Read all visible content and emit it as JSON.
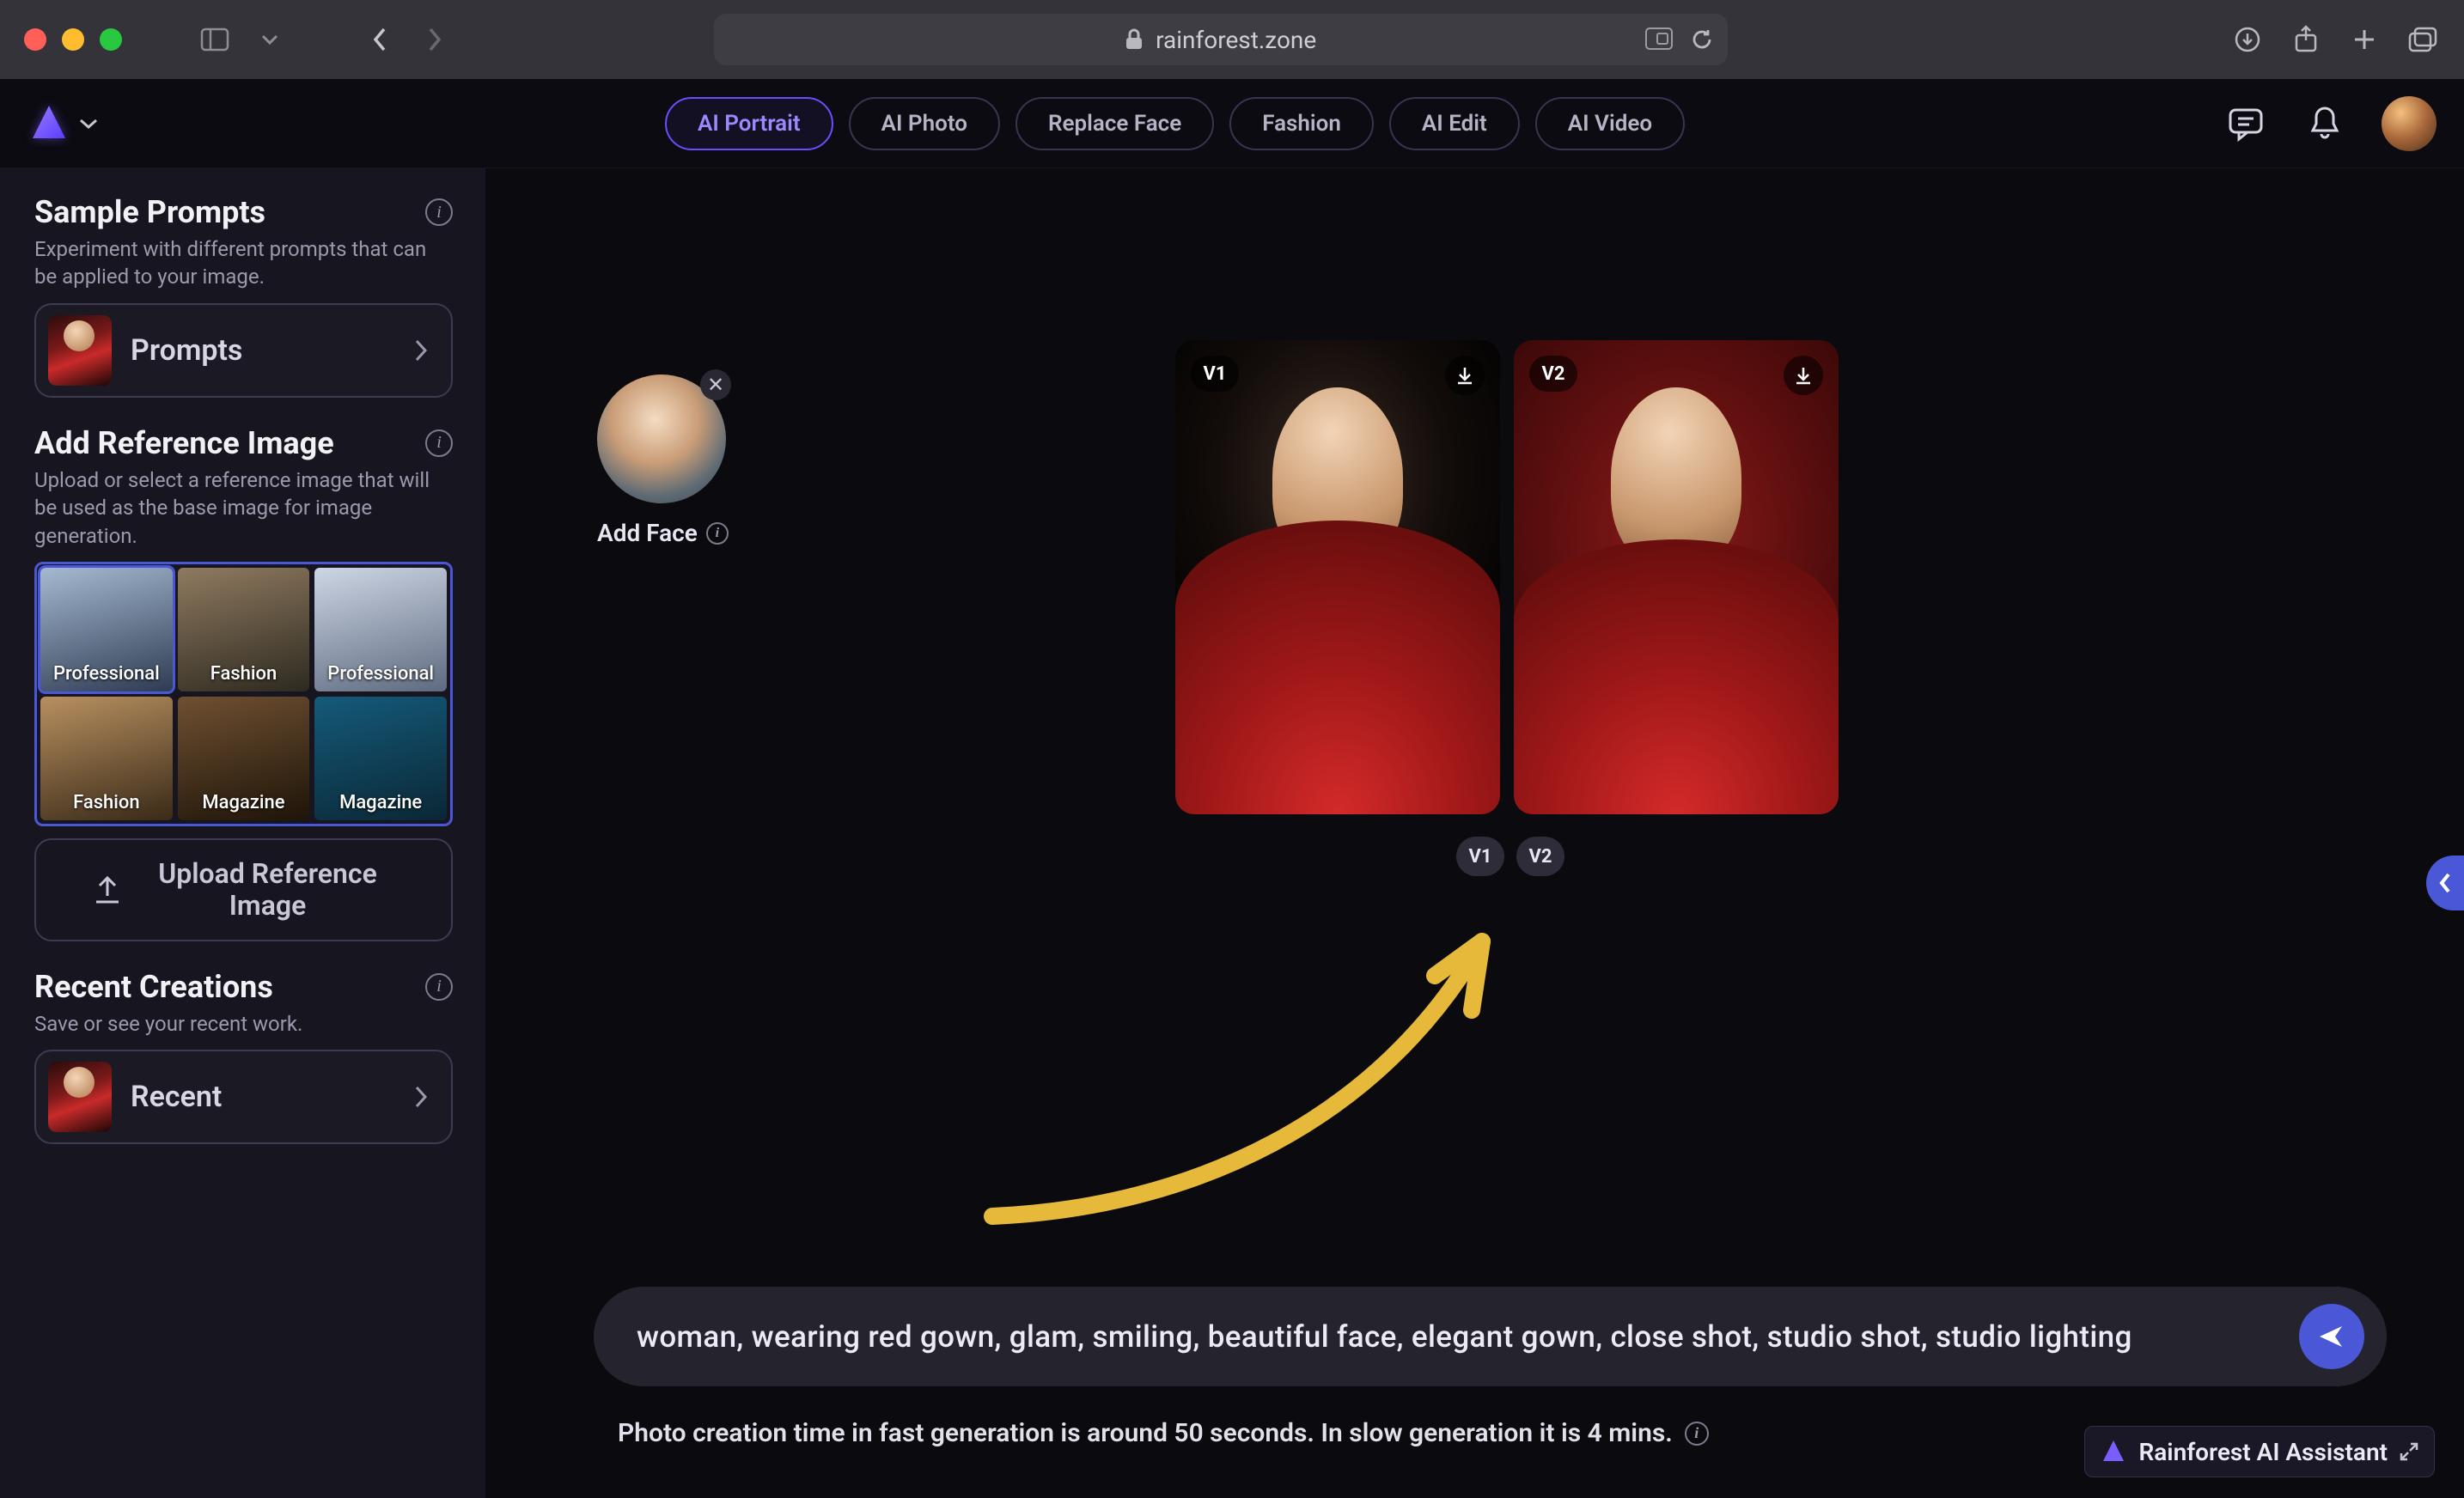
{
  "browser": {
    "url_host": "rainforest.zone"
  },
  "modes": [
    {
      "label": "AI Portrait",
      "active": true
    },
    {
      "label": "AI Photo",
      "active": false
    },
    {
      "label": "Replace Face",
      "active": false
    },
    {
      "label": "Fashion",
      "active": false
    },
    {
      "label": "AI Edit",
      "active": false
    },
    {
      "label": "AI Video",
      "active": false
    }
  ],
  "sidebar": {
    "sample": {
      "title": "Sample Prompts",
      "sub": "Experiment with different prompts that can be applied to your image.",
      "card_label": "Prompts"
    },
    "reference": {
      "title": "Add Reference Image",
      "sub": "Upload or select a reference image that will be used as the base image for image generation.",
      "cells": [
        {
          "tag": "Professional"
        },
        {
          "tag": "Fashion"
        },
        {
          "tag": "Professional"
        },
        {
          "tag": "Fashion"
        },
        {
          "tag": "Magazine"
        },
        {
          "tag": "Magazine"
        }
      ],
      "upload_label": "Upload Reference Image"
    },
    "recent": {
      "title": "Recent Creations",
      "sub": "Save or see your recent work.",
      "card_label": "Recent"
    }
  },
  "face_slot": {
    "label": "Add Face"
  },
  "outputs": [
    {
      "badge": "V1"
    },
    {
      "badge": "V2"
    }
  ],
  "v_pills": [
    "V1",
    "V2"
  ],
  "prompt": {
    "text": "woman, wearing red gown, glam, smiling, beautiful face,  elegant gown,  close shot, studio shot, studio lighting"
  },
  "hint": "Photo creation time in fast generation is around 50 seconds. In slow generation it is 4 mins.",
  "assistant": {
    "label": "Rainforest AI Assistant"
  }
}
